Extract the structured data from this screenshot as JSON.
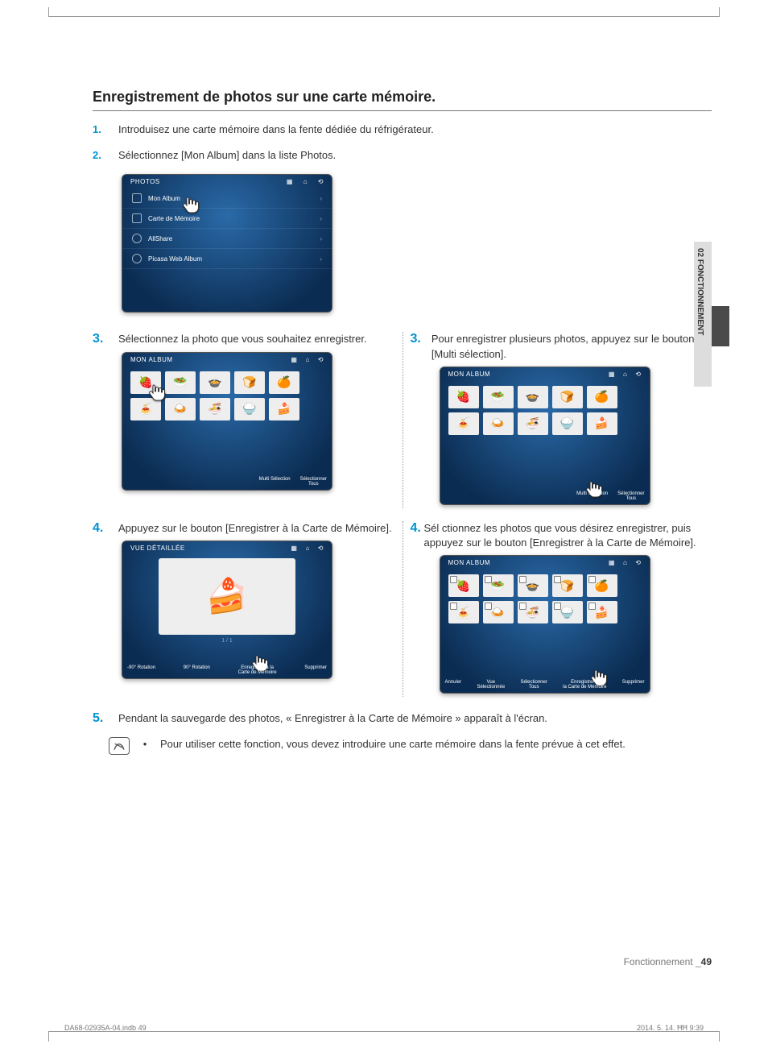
{
  "heading": "Enregistrement de photos sur une carte mémoire.",
  "steps": {
    "s1": {
      "num": "1.",
      "text": "Introduisez une carte mémoire dans la fente dédiée du réfrigérateur."
    },
    "s2": {
      "num": "2.",
      "text": "Sélectionnez [Mon Album] dans la liste Photos."
    },
    "s3L": {
      "num": "3.",
      "text": "Sélectionnez la photo que vous souhaitez enregistrer."
    },
    "s3R": {
      "num": "3.",
      "text": "Pour enregistrer plusieurs photos, appuyez sur le bouton [Multi sélection]."
    },
    "s4L": {
      "num": "4.",
      "text": "Appuyez sur le bouton [Enregistrer à la Carte de Mémoire]."
    },
    "s4R": {
      "num": "4.",
      "text": "Sél ctionnez les photos que vous désirez enregistrer, puis appuyez sur le bouton [Enregistrer à la Carte de Mémoire]."
    },
    "s5": {
      "num": "5.",
      "text": "Pendant la sauvegarde des photos, « Enregistrer à la Carte de Mémoire » apparaît à l'écran."
    }
  },
  "note": "Pour utiliser cette fonction, vous devez introduire une carte mémoire dans la fente prévue à cet effet.",
  "device_photos": {
    "title": "PHOTOS",
    "items": [
      "Mon Album",
      "Carte de Mémoire",
      "AllShare",
      "Picasa Web Album"
    ]
  },
  "device_album": {
    "title": "MON ALBUM",
    "bottom": {
      "multi": "Multi Sélection",
      "selall": "Sélectionner\nTous"
    }
  },
  "device_detail": {
    "title": "VUE DÉTAILLÉE",
    "pager": "1 / 1",
    "bottom": {
      "rotneg": "-90° Rotation",
      "rotpos": "90° Rotation",
      "save": "Enregistrer à la\nCarte de Mémoire",
      "del": "Supprimer"
    }
  },
  "device_album_multi": {
    "title": "MON ALBUM",
    "bottom": {
      "cancel": "Annuler",
      "viewsel": "Vue\nSélectionnée",
      "selall": "Sélectionner\nTous",
      "save": "Enregistrer à\nla Carte de Mémoire",
      "del": "Supprimer"
    }
  },
  "sidetab": "02  FONCTIONNEMENT",
  "footer": {
    "section": "Fonctionnement _",
    "page": "49"
  },
  "indb": {
    "left": "DA68-02935A-04.indb   49",
    "right": "2014. 5. 14.   ĦĦ 9:39"
  }
}
